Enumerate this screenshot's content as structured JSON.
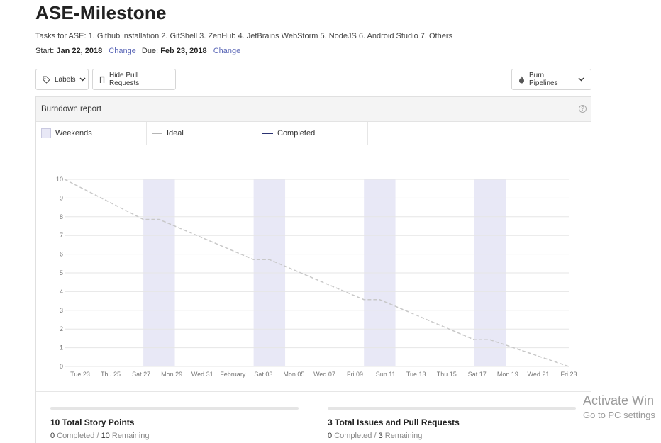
{
  "milestone": {
    "title": "ASE-Milestone",
    "description": "Tasks for ASE: 1. Github installation 2. GitShell 3. ZenHub 4. JetBrains WebStorm 5. NodeJS 6. Android Studio 7. Others",
    "start_label": "Start:",
    "start_date": "Jan 22, 2018",
    "due_label": "Due:",
    "due_date": "Feb 23, 2018",
    "change_label": "Change"
  },
  "toolbar": {
    "labels": "Labels",
    "hide_pull_requests": "Hide Pull Requests",
    "burn_pipelines": "Burn Pipelines"
  },
  "report": {
    "title": "Burndown report",
    "help_icon": "question-circle-icon",
    "legend": [
      {
        "label": "Weekends",
        "color": "#e8e8f6"
      },
      {
        "label": "Ideal",
        "color": "#b5b5b5"
      },
      {
        "label": "Completed",
        "color": "#2b3272"
      }
    ]
  },
  "chart_data": {
    "type": "line",
    "ylim": [
      0,
      10
    ],
    "yticks": [
      0,
      1,
      2,
      3,
      4,
      5,
      6,
      7,
      8,
      9,
      10
    ],
    "x_tick_labels": [
      "Tue 23",
      "Thu 25",
      "Sat 27",
      "Mon 29",
      "Wed 31",
      "February",
      "Sat 03",
      "Mon 05",
      "Wed 07",
      "Fri 09",
      "Sun 11",
      "Tue 13",
      "Thu 15",
      "Sat 17",
      "Mon 19",
      "Wed 21",
      "Fri 23"
    ],
    "weekends": [
      [
        "Jan 27",
        "Jan 28"
      ],
      [
        "Feb 03",
        "Feb 04"
      ],
      [
        "Feb 10",
        "Feb 11"
      ],
      [
        "Feb 17",
        "Feb 18"
      ]
    ],
    "series": [
      {
        "name": "Ideal",
        "style": "dashed",
        "color": "#c8c8c8",
        "points": [
          [
            "Jan 22",
            10
          ],
          [
            "Jan 27",
            7.86
          ],
          [
            "Jan 28",
            7.86
          ],
          [
            "Feb 03",
            5.71
          ],
          [
            "Feb 04",
            5.71
          ],
          [
            "Feb 10",
            3.57
          ],
          [
            "Feb 11",
            3.57
          ],
          [
            "Feb 17",
            1.43
          ],
          [
            "Feb 18",
            1.43
          ],
          [
            "Feb 23",
            0
          ]
        ]
      },
      {
        "name": "Completed",
        "color": "#2b3272",
        "points": []
      }
    ]
  },
  "stats": {
    "story_points_title": "10 Total Story Points",
    "story_points_completed": "0",
    "story_points_remaining": "10",
    "issues_title": "3 Total Issues and Pull Requests",
    "issues_completed": "0",
    "issues_remaining": "3",
    "completed_label": "Completed",
    "remaining_label": "Remaining"
  },
  "watermark": {
    "line1": "Activate Win",
    "line2": "Go to PC settings"
  }
}
